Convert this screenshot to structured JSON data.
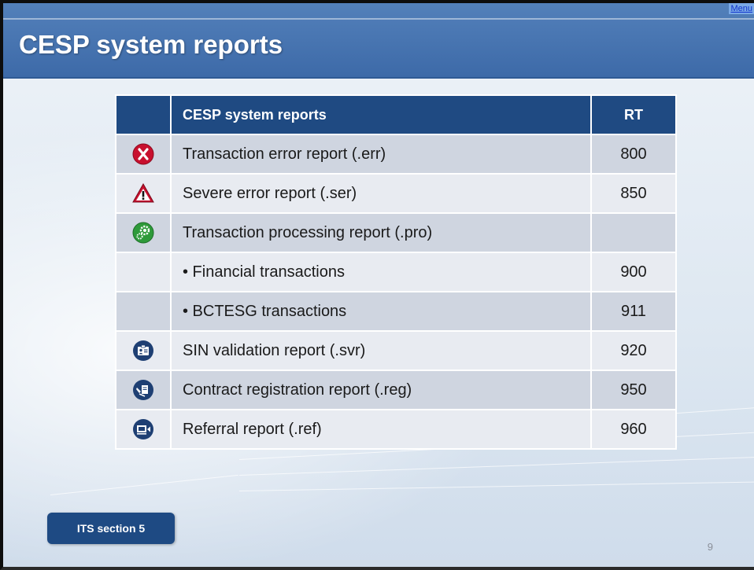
{
  "header": {
    "title": "CESP system reports",
    "menu_label": "Menu"
  },
  "table": {
    "headers": {
      "name": "CESP system reports",
      "rt": "RT"
    },
    "rows": [
      {
        "icon": "error-x-icon",
        "label": "Transaction error report (.err)",
        "rt": "800"
      },
      {
        "icon": "warning-triangle-icon",
        "label": "Severe error report (.ser)",
        "rt": "850"
      },
      {
        "icon": "gears-icon",
        "label": "Transaction processing report (.pro)",
        "rt": ""
      },
      {
        "icon": "",
        "label": "• Financial transactions",
        "rt": "900"
      },
      {
        "icon": "",
        "label": "• BCTESG transactions",
        "rt": "911"
      },
      {
        "icon": "id-card-icon",
        "label": "SIN validation report (.svr)",
        "rt": "920"
      },
      {
        "icon": "contract-sign-icon",
        "label": "Contract registration report (.reg)",
        "rt": "950"
      },
      {
        "icon": "referral-screen-icon",
        "label": "Referral report (.ref)",
        "rt": "960"
      }
    ]
  },
  "footer": {
    "its_button": "ITS section 5",
    "page_number": "9"
  },
  "colors": {
    "header_blue": "#3d6aa8",
    "table_header": "#1f4a82",
    "error_red": "#c8102e",
    "success_green": "#2e9a3a",
    "icon_navy": "#1e3f73"
  }
}
